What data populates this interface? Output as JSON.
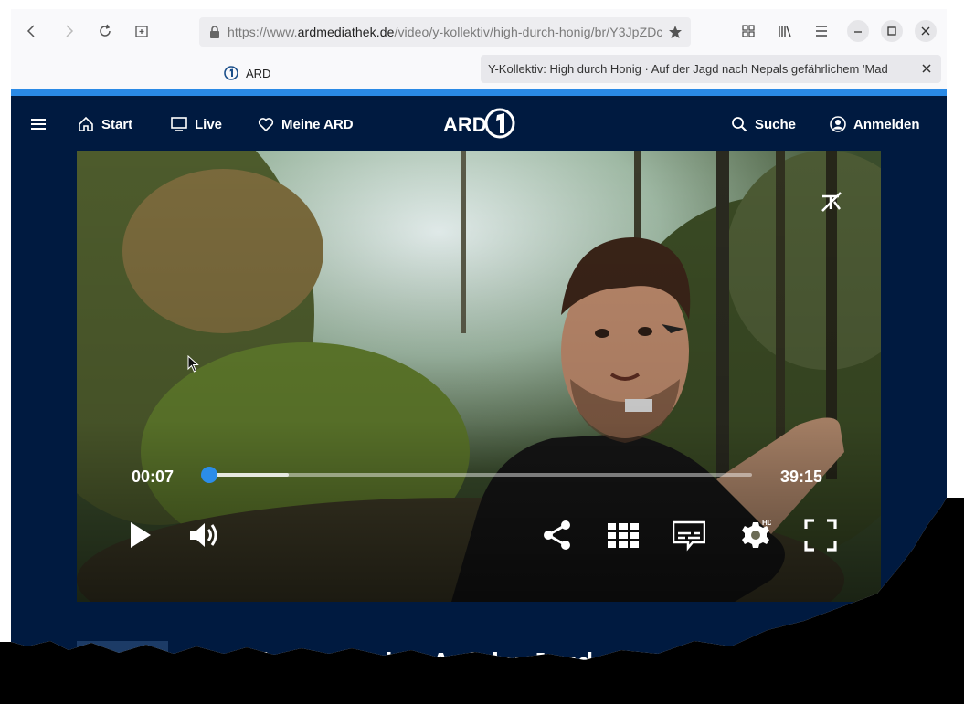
{
  "browser": {
    "url_prefix": "https://www.",
    "url_domain": "ardmediathek.de",
    "url_path": "/video/y-kollektiv/high-durch-honig/br/Y3JpZDc",
    "tabs": [
      {
        "label": "ARD"
      },
      {
        "label": "Y-Kollektiv: High durch Honig · Auf der Jagd nach Nepals gefährlichem 'Mad"
      }
    ],
    "icons": [
      "back-icon",
      "forward-icon",
      "reload-icon",
      "new-tab-icon",
      "lock-icon",
      "bookmark-star-icon",
      "apps-grid-icon",
      "library-icon",
      "menu-icon",
      "minimize-icon",
      "maximize-icon",
      "close-icon"
    ]
  },
  "site_nav": {
    "start": "Start",
    "live": "Live",
    "meine_ard": "Meine ARD",
    "logo": "ARD",
    "suche": "Suche",
    "anmelden": "Anmelden"
  },
  "player": {
    "current_time": "00:07",
    "duration": "39:15",
    "progress_fraction": 0.003,
    "buffered_fraction": 0.15,
    "accent_color": "#2b8de9",
    "hd_badge": "HD"
  },
  "episode": {
    "title": "High durch Honig · Auf der Jagd"
  },
  "colors": {
    "page_bg": "#001a40",
    "loading_bar": "#2a8ae6"
  }
}
